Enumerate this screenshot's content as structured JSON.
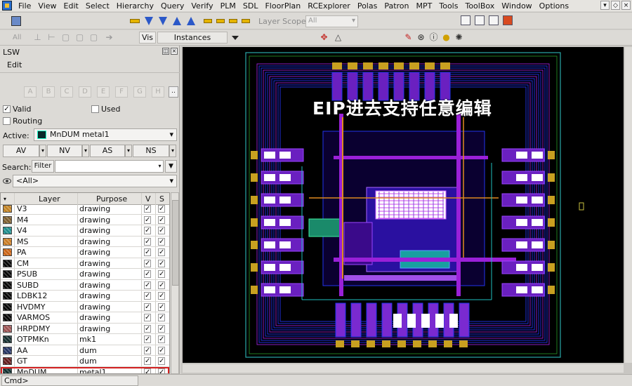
{
  "menu": [
    "File",
    "View",
    "Edit",
    "Select",
    "Hierarchy",
    "Query",
    "Verify",
    "PLM",
    "SDL",
    "FloorPlan",
    "RCExplorer",
    "Polas",
    "Patron",
    "MPT",
    "Tools",
    "ToolBox",
    "Window",
    "Options"
  ],
  "toolbar": {
    "layer_scope_label": "Layer Scope",
    "layer_scope_value": "All"
  },
  "toolbar2": {
    "all_label": "All",
    "vis_label": "Vis",
    "instances_label": "Instances"
  },
  "lsw": {
    "title": "LSW",
    "edit_label": "Edit",
    "letter_buttons": [
      "A",
      "B",
      "C",
      "D",
      "E",
      "F",
      "G",
      "H"
    ],
    "more_label": "..",
    "valid_label": "Valid",
    "used_label": "Used",
    "routing_label": "Routing",
    "active_label": "Active:",
    "active_value": "MnDUM metal1",
    "seg_buttons": [
      "AV",
      "NV",
      "AS",
      "NS"
    ],
    "search_label": "Search:",
    "filter_label": "Filter",
    "search_value": "",
    "all_value": "<All>",
    "col_layer": "Layer",
    "col_purpose": "Purpose",
    "col_v": "V",
    "col_s": "S",
    "check": "✓",
    "rows": [
      {
        "layer": "V3",
        "purpose": "drawing",
        "color": "#c08020"
      },
      {
        "layer": "M4",
        "purpose": "drawing",
        "color": "#7a5a2a"
      },
      {
        "layer": "V4",
        "purpose": "drawing",
        "color": "#1a8a8a"
      },
      {
        "layer": "MS",
        "purpose": "drawing",
        "color": "#c87a20"
      },
      {
        "layer": "PA",
        "purpose": "drawing",
        "color": "#c86010"
      },
      {
        "layer": "CM",
        "purpose": "drawing",
        "color": "#000000"
      },
      {
        "layer": "PSUB",
        "purpose": "drawing",
        "color": "#000000"
      },
      {
        "layer": "SUBD",
        "purpose": "drawing",
        "color": "#000000"
      },
      {
        "layer": "LDBK12",
        "purpose": "drawing",
        "color": "#000000"
      },
      {
        "layer": "HVDMY",
        "purpose": "drawing",
        "color": "#000000"
      },
      {
        "layer": "VARMOS",
        "purpose": "drawing",
        "color": "#000000"
      },
      {
        "layer": "HRPDMY",
        "purpose": "drawing",
        "color": "#9a5050"
      },
      {
        "layer": "OTPMKn",
        "purpose": "mk1",
        "color": "#102a2a"
      },
      {
        "layer": "AA",
        "purpose": "dum",
        "color": "#203060"
      },
      {
        "layer": "GT",
        "purpose": "dum",
        "color": "#601818"
      },
      {
        "layer": "MnDUM",
        "purpose": "metal1",
        "color": "#0a2a2a"
      }
    ]
  },
  "canvas": {
    "overlay_text": "EIP进去支持任意编辑"
  },
  "status": {
    "cmd_label": "Cmd>"
  },
  "colors": {
    "canvas_bg": "#000000",
    "metal_blue": "#2233ee",
    "metal_purple": "#9a20d8",
    "pad_white": "#ffffff",
    "highlight": "#d32020"
  }
}
